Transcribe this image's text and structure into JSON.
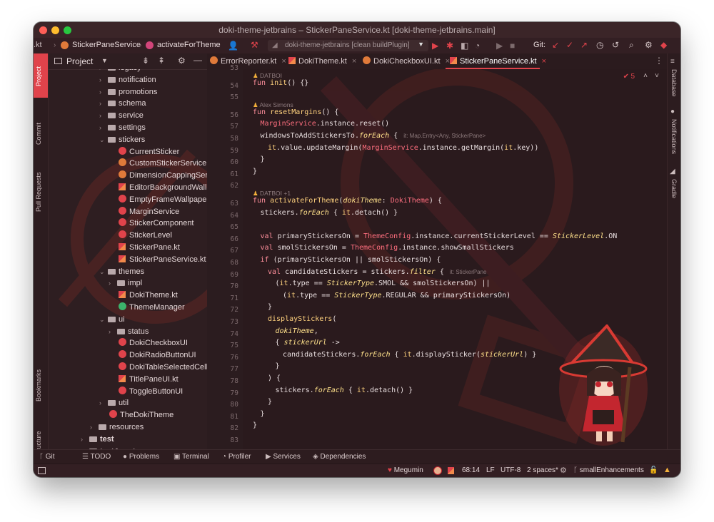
{
  "window": {
    "title": "doki-theme-jetbrains – StickerPaneService.kt [doki-theme-jetbrains.main]"
  },
  "toolbar": {
    "breadcrumbs": [
      ".kt",
      "StickerPaneService",
      "activateForTheme"
    ],
    "run_config": "doki-theme-jetbrains [clean buildPlugin]",
    "git_label": "Git:"
  },
  "left_strip": [
    "Project",
    "Commit",
    "Pull Requests",
    "Bookmarks",
    "Structure"
  ],
  "right_strip": [
    "Database",
    "Notifications",
    "Gradle"
  ],
  "project": {
    "title": "Project",
    "tree": [
      {
        "label": "legacy",
        "kind": "folder",
        "depth": 1,
        "state": "collapsed"
      },
      {
        "label": "notification",
        "kind": "folder",
        "depth": 1,
        "state": "collapsed"
      },
      {
        "label": "promotions",
        "kind": "folder",
        "depth": 1,
        "state": "collapsed"
      },
      {
        "label": "schema",
        "kind": "folder",
        "depth": 1,
        "state": "collapsed"
      },
      {
        "label": "service",
        "kind": "folder",
        "depth": 1,
        "state": "collapsed"
      },
      {
        "label": "settings",
        "kind": "folder",
        "depth": 1,
        "state": "collapsed"
      },
      {
        "label": "stickers",
        "kind": "folder",
        "depth": 1,
        "state": "expanded"
      },
      {
        "label": "CurrentSticker",
        "kind": "class",
        "depth": 2
      },
      {
        "label": "CustomStickerService",
        "kind": "class",
        "depth": 2
      },
      {
        "label": "DimensionCappingServ",
        "kind": "class",
        "depth": 2
      },
      {
        "label": "EditorBackgroundWallp",
        "kind": "kotlin",
        "depth": 2
      },
      {
        "label": "EmptyFrameWallpaper",
        "kind": "class",
        "depth": 2
      },
      {
        "label": "MarginService",
        "kind": "class",
        "depth": 2
      },
      {
        "label": "StickerComponent",
        "kind": "class",
        "depth": 2
      },
      {
        "label": "StickerLevel",
        "kind": "class",
        "depth": 2
      },
      {
        "label": "StickerPane.kt",
        "kind": "kotlin",
        "depth": 2
      },
      {
        "label": "StickerPaneService.kt",
        "kind": "kotlin",
        "depth": 2
      },
      {
        "label": "themes",
        "kind": "folder",
        "depth": 1,
        "state": "expanded"
      },
      {
        "label": "impl",
        "kind": "folder",
        "depth": 2,
        "state": "collapsed"
      },
      {
        "label": "DokiTheme.kt",
        "kind": "kotlin",
        "depth": 2
      },
      {
        "label": "ThemeManager",
        "kind": "class-green",
        "depth": 2
      },
      {
        "label": "ui",
        "kind": "folder",
        "depth": 1,
        "state": "expanded"
      },
      {
        "label": "status",
        "kind": "folder",
        "depth": 2,
        "state": "collapsed"
      },
      {
        "label": "DokiCheckboxUI",
        "kind": "class",
        "depth": 2
      },
      {
        "label": "DokiRadioButtonUI",
        "kind": "class",
        "depth": 2
      },
      {
        "label": "DokiTableSelectedCell",
        "kind": "class",
        "depth": 2
      },
      {
        "label": "TitlePaneUI.kt",
        "kind": "kotlin",
        "depth": 2
      },
      {
        "label": "ToggleButtonUI",
        "kind": "class",
        "depth": 2
      },
      {
        "label": "util",
        "kind": "folder",
        "depth": 1,
        "state": "collapsed"
      },
      {
        "label": "TheDokiTheme",
        "kind": "class",
        "depth": 1
      },
      {
        "label": "resources",
        "kind": "folder",
        "depth": 0,
        "state": "collapsed"
      },
      {
        "label": "test",
        "kind": "folder",
        "depth": -1,
        "state": "collapsed"
      },
      {
        "label": "testAssets",
        "kind": "folder",
        "depth": -1,
        "state": "collapsed"
      }
    ]
  },
  "tabs": [
    {
      "label": "ErrorReporter.kt",
      "active": false
    },
    {
      "label": "DokiTheme.kt",
      "active": false
    },
    {
      "label": "DokiCheckboxUI.kt",
      "active": false
    },
    {
      "label": "StickerPaneService.kt",
      "active": true
    }
  ],
  "inspection": {
    "count": "5"
  },
  "editor": {
    "line_numbers": [
      "53",
      "54",
      "55",
      "56",
      "57",
      "58",
      "59",
      "60",
      "61",
      "62",
      "63",
      "64",
      "65",
      "66",
      "67",
      "68",
      "69",
      "70",
      "71",
      "72",
      "73",
      "74",
      "75",
      "76",
      "77",
      "78",
      "79",
      "80",
      "81",
      "82",
      "83"
    ],
    "authors": [
      "DATBOI",
      "Alex Simons",
      "DATBOI +1"
    ],
    "code": {
      "l54": [
        "fun ",
        "init",
        "() {}"
      ],
      "l56": [
        "fun ",
        "resetMargins",
        "() {"
      ],
      "l57": [
        "MarginService",
        ".instance.reset()"
      ],
      "l58": [
        "windowsToAddStickersTo.",
        "forEach",
        " { ",
        "it: Map.Entry<Any, StickerPane>"
      ],
      "l59": [
        "it",
        ".value.updateMargin(",
        "MarginService",
        ".instance.getMargin(",
        "it",
        ".key))"
      ],
      "l60": [
        "}"
      ],
      "l61": [
        "}"
      ],
      "l63": [
        "fun ",
        "activateForTheme",
        "(",
        "dokiTheme",
        ": ",
        "DokiTheme",
        ") {"
      ],
      "l64": [
        "stickers.",
        "forEach",
        " { ",
        "it",
        ".detach() }"
      ],
      "l66": [
        "val ",
        "primaryStickersOn",
        " = ",
        "ThemeConfig",
        ".instance.currentStickerLevel == ",
        "StickerLevel",
        ".ON"
      ],
      "l67": [
        "val ",
        "smolStickersOn",
        " = ",
        "ThemeConfig",
        ".instance.showSmallStickers"
      ],
      "l68": [
        "if",
        " (primaryStickersOn || smolStickersOn) {"
      ],
      "l69": [
        "val ",
        "candidateStickers",
        " = stickers.",
        "filter",
        " { ",
        "it: StickerPane"
      ],
      "l70": [
        "(",
        "it",
        ".type == ",
        "StickerType",
        ".SMOL && smolStickersOn) ||"
      ],
      "l71": [
        "(",
        "it",
        ".type == ",
        "StickerType",
        ".REGULAR && primaryStickersOn)"
      ],
      "l72": [
        "}"
      ],
      "l73": [
        "displayStickers",
        "("
      ],
      "l74": [
        "dokiTheme",
        ","
      ],
      "l75": [
        "{ ",
        "stickerUrl",
        " ->"
      ],
      "l76": [
        "candidateStickers.",
        "forEach",
        " { ",
        "it",
        ".displaySticker(",
        "stickerUrl",
        ") }"
      ],
      "l77": [
        "}"
      ],
      "l78": [
        ") {"
      ],
      "l79": [
        "stickers.",
        "forEach",
        " { ",
        "it",
        ".detach() }"
      ],
      "l80": [
        "}"
      ],
      "l81": [
        "}"
      ],
      "l82": [
        "}"
      ]
    }
  },
  "bottom_tools": [
    "Git",
    "TODO",
    "Problems",
    "Terminal",
    "Profiler",
    "Services",
    "Dependencies"
  ],
  "status": {
    "theme": "Megumin",
    "position": "68:14",
    "line_sep": "LF",
    "encoding": "UTF-8",
    "indent": "2 spaces*",
    "branch": "smallEnhancements"
  },
  "colors": {
    "accent": "#e0434b",
    "bg": "#2a1a1d",
    "keyword": "#ff8f9c",
    "function": "#ffd27e"
  }
}
